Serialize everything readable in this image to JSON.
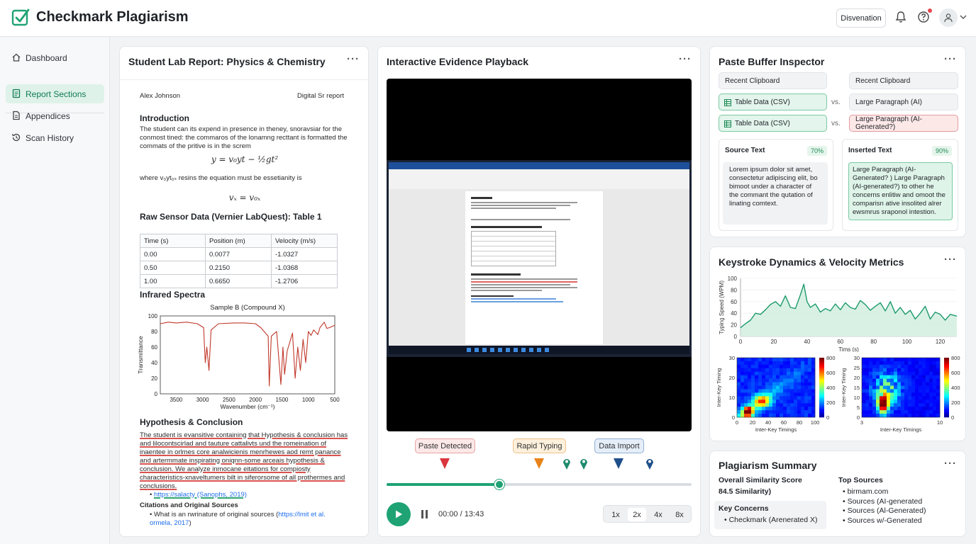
{
  "app": {
    "title": "Checkmark Plagiarism",
    "dropdown_label": "Disvenation"
  },
  "sidebar": {
    "items": [
      {
        "label": "Dashboard",
        "active": false
      },
      {
        "label": "Report Sections",
        "active": true
      },
      {
        "label": "Appendices",
        "active": false
      },
      {
        "label": "Scan History",
        "active": false
      }
    ]
  },
  "report": {
    "title": "Student Lab Report: Physics & Chemistry",
    "author": "Alex Johnson",
    "doc_type": "Digital Sr report",
    "intro_heading": "Introduction",
    "intro_text": "The student can its expend in presence in theney, snoravsiar for the conmost tined: the commaros of the lonamng recttant is formatted the commats of the pritive is in the screm",
    "equation1": "y = v₀yt − ½gt²",
    "where_text": "where v₀yt₀ₛ resins the equation must be essetianity is",
    "equation2": "vₓ = v₀ₓ",
    "table_heading": "Raw Sensor Data (Vernier LabQuest): Table 1",
    "table_headers": [
      "Time (s)",
      "Position (m)",
      "Velocity (m/s)"
    ],
    "table_rows": [
      [
        "0.00",
        "0.0077",
        "-1.0327"
      ],
      [
        "0.50",
        "0.2150",
        "-1.0368"
      ],
      [
        "1.00",
        "0.6650",
        "-1.2706"
      ]
    ],
    "spectra_heading": "Infrared Spectra",
    "spectra_chart": {
      "type": "line",
      "title": "Sample B (Compound X)",
      "xlabel": "Wavenumber (cm⁻¹)",
      "ylabel": "Transmittance",
      "x_ticks": [
        "3500",
        "3000",
        "2500",
        "2000",
        "1500",
        "1000",
        "500"
      ],
      "y_ticks": [
        "0",
        "20",
        "40",
        "60",
        "80",
        "100"
      ],
      "xlim": [
        3800,
        500
      ],
      "ylim": [
        0,
        100
      ],
      "reversed_x": true,
      "series": [
        {
          "x": [
            3800,
            3650,
            3500,
            3300,
            3100,
            2980,
            2950,
            2920,
            2880,
            2840,
            2700,
            2400,
            2200,
            2000,
            1900,
            1760,
            1740,
            1700,
            1600,
            1520,
            1480,
            1450,
            1400,
            1300,
            1250,
            1200,
            1150,
            1100,
            1050,
            1000,
            950,
            900,
            820,
            780,
            700,
            650,
            600,
            500
          ],
          "y": [
            90,
            92,
            91,
            92,
            90,
            85,
            40,
            60,
            30,
            82,
            90,
            91,
            91,
            90,
            85,
            74,
            10,
            74,
            80,
            12,
            60,
            25,
            55,
            78,
            20,
            60,
            30,
            70,
            40,
            80,
            75,
            82,
            76,
            85,
            92,
            84,
            85,
            88
          ]
        }
      ]
    },
    "hyp_heading": "Hypothesis & Conclusion",
    "hyp_text": "The student is evansitive containing that Hypothesis & conclusion has and lilocontscirlad and tauture cattalivts und the romeination of inaentee in orlmes core analwicienis menrhewes aod remt panance and artermmate inspirating oniqnn-some arceais hypothesis & conclusion. We analyze inmocane eitations for compiosty characteristics-xnaveltumers bilt in siferorsome of all prothermes and conclusions.",
    "ref1": "https://salacty (Sanophs, 2019)",
    "citations_heading": "Citations and Original Sources",
    "citation_item_prefix": "What is an rwrinature of original sources (",
    "citation_item_link": "https://lmit et al. ormela, 2017",
    "citation_item_suffix": ")"
  },
  "playback": {
    "title": "Interactive Evidence Playback",
    "markers": [
      {
        "label": "Paste Detected",
        "color": "#d9363e"
      },
      {
        "label": "Rapid Typing",
        "color": "#e8831a"
      },
      {
        "label": "Data Import",
        "color": "#1f4f8b"
      }
    ],
    "progress": 0.37,
    "time": "00:00 / 13:43",
    "speeds": [
      "1x",
      "2x",
      "4x",
      "8x"
    ],
    "active_speed": "2x"
  },
  "paste": {
    "title": "Paste Buffer Inspector",
    "left_header": "Recent Clipboard",
    "right_header": "Recent Clipboard",
    "vs": "vs.",
    "rows": [
      {
        "left": "Table Data (CSV)",
        "right": "Large Paragraph (AI)",
        "flag": false
      },
      {
        "left": "Table Data (CSV)",
        "right": "Large Paragraph (AI-Generated?)",
        "flag": true
      }
    ],
    "source_title": "Source Text",
    "source_pct": "70%",
    "source_text": "Lorem ipsum dolor sit amet, consectetur adipiscing elit, bo bimoot under a character of the commant the qutation of linating comtext.",
    "inserted_title": "Inserted Text",
    "inserted_pct": "90%",
    "inserted_text": "Large Paragraph (AI-Generated? ) Large Paragraph (AI-generated?) to other he concerns enlitiw and omoot the comparisn ative insolited alrer ewsmrus sraponol intestion."
  },
  "keystroke": {
    "title": "Keystroke Dynamics & Velocity Metrics",
    "line_chart": {
      "type": "area",
      "xlabel": "Tims (s)",
      "ylabel": "Typing Speed (WPM)",
      "x_ticks": [
        "0",
        "20",
        "40",
        "60",
        "80",
        "100",
        "120"
      ],
      "y_ticks": [
        "0",
        "20",
        "40",
        "60",
        "80",
        "100"
      ],
      "xlim": [
        0,
        130
      ],
      "ylim": [
        0,
        100
      ],
      "x": [
        0,
        3,
        6,
        9,
        12,
        15,
        18,
        21,
        24,
        27,
        30,
        33,
        36,
        38,
        40,
        42,
        45,
        48,
        51,
        54,
        57,
        60,
        63,
        66,
        69,
        72,
        75,
        78,
        81,
        84,
        87,
        90,
        93,
        96,
        99,
        102,
        105,
        108,
        111,
        114,
        117,
        120,
        123,
        126,
        130
      ],
      "y": [
        15,
        22,
        28,
        40,
        38,
        46,
        55,
        60,
        52,
        70,
        50,
        48,
        72,
        90,
        60,
        50,
        56,
        42,
        48,
        44,
        56,
        46,
        58,
        50,
        47,
        62,
        55,
        45,
        52,
        58,
        44,
        60,
        40,
        50,
        38,
        45,
        30,
        40,
        52,
        30,
        42,
        38,
        28,
        38,
        35
      ]
    },
    "heatmap1": {
      "type": "heatmap",
      "xlabel": "Inter-Key Timings",
      "ylabel": "Inter-Key Timing",
      "x_ticks": [
        "0",
        "20",
        "40",
        "60",
        "80",
        "100"
      ],
      "y_ticks": [
        "0",
        "10",
        "20",
        "30"
      ],
      "colorbar_ticks": [
        "0",
        "200",
        "400",
        "600",
        "800"
      ]
    },
    "heatmap2": {
      "type": "heatmap",
      "xlabel": "Inter-Key Timings",
      "ylabel": "Inter-Key Timing",
      "x_ticks": [
        "3",
        "10"
      ],
      "y_ticks": [
        "0",
        "5",
        "10",
        "15",
        "20",
        "25",
        "30"
      ],
      "colorbar_ticks": [
        "0",
        "200",
        "400",
        "600",
        "800"
      ]
    }
  },
  "summary": {
    "title": "Plagiarism Summary",
    "score_label": "Overall Similarity Score",
    "score_value": "84.5 Similarity)",
    "concerns_label": "Key Concerns",
    "concerns": [
      "Checkmark (Arenerated X)"
    ],
    "sources_label": "Top Sources",
    "sources": [
      "birmam.com",
      "Sources (AI-generated",
      "Sources (Al-Generated)",
      "Sources w/-Generated"
    ]
  },
  "colors": {
    "accent": "#1fa374",
    "accent_bg": "#dff2ea",
    "danger": "#d9363e",
    "warning": "#e8831a",
    "info": "#1f4f8b"
  }
}
